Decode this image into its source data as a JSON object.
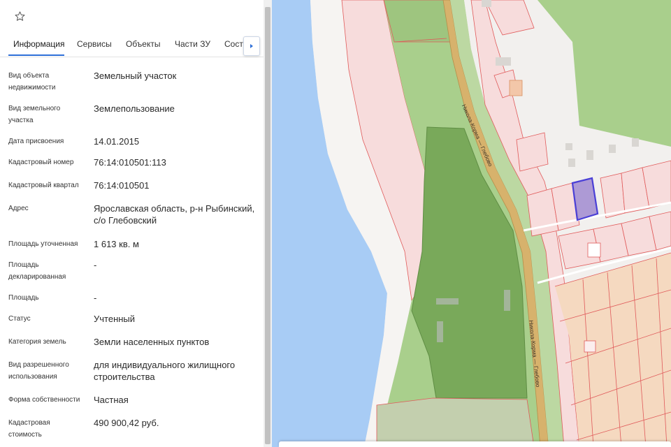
{
  "tabs": [
    {
      "label": "Информация",
      "active": true
    },
    {
      "label": "Сервисы",
      "active": false
    },
    {
      "label": "Объекты",
      "active": false
    },
    {
      "label": "Части ЗУ",
      "active": false
    },
    {
      "label": "Соста",
      "active": false
    }
  ],
  "info": [
    {
      "label": "Вид объекта недвижимости",
      "value": "Земельный участок"
    },
    {
      "label": "Вид земельного участка",
      "value": "Землепользование"
    },
    {
      "label": "Дата присвоения",
      "value": "14.01.2015"
    },
    {
      "label": "Кадастровый номер",
      "value": "76:14:010501:113"
    },
    {
      "label": "Кадастровый квартал",
      "value": "76:14:010501"
    },
    {
      "label": "Адрес",
      "value": "Ярославская область, р-н Рыбинский, с/о Глебовский"
    },
    {
      "label": "Площадь уточненная",
      "value": "1 613 кв. м"
    },
    {
      "label": "Площадь декларированная",
      "value": "-"
    },
    {
      "label": "Площадь",
      "value": "-"
    },
    {
      "label": "Статус",
      "value": "Учтенный"
    },
    {
      "label": "Категория земель",
      "value": "Земли населенных пунктов"
    },
    {
      "label": "Вид разрешенного использования",
      "value": "для индивидуального жилищного строительства"
    },
    {
      "label": "Форма собственности",
      "value": "Частная"
    },
    {
      "label": "Кадастровая стоимость",
      "value": "490 900,42 руб."
    }
  ],
  "map": {
    "road_label_top": "Никола-Корма — Глебово",
    "road_label_bottom": "Никола-Корма — Глебово"
  },
  "icons": {
    "favorite": "star-outline-icon",
    "tabs_scroll": "chevron-right-icon"
  },
  "colors": {
    "accent": "#2e6fd8",
    "water": "#a8ccf5",
    "parcel_stroke": "#e05a5a",
    "selected_parcel": "#4a3fd6",
    "forest": "#a9cf8c",
    "road": "#d7b26c"
  }
}
